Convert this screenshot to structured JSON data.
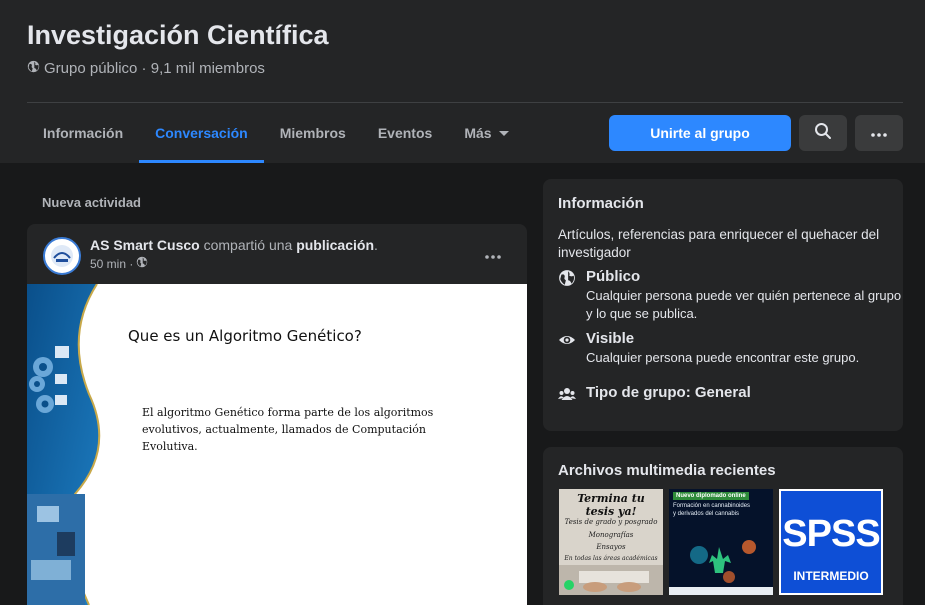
{
  "header": {
    "title": "Investigación Científica",
    "subtitle": "Grupo público · 9,1 mil miembros",
    "icon": "globe-icon"
  },
  "tabs": [
    {
      "label": "Información",
      "active": false
    },
    {
      "label": "Conversación",
      "active": true
    },
    {
      "label": "Miembros",
      "active": false
    },
    {
      "label": "Eventos",
      "active": false
    },
    {
      "label": "Más",
      "active": false
    }
  ],
  "actions": {
    "join_label": "Unirte al grupo",
    "search_icon": "search-icon",
    "more_icon": "more-icon"
  },
  "feed": {
    "section_label": "Nueva actividad",
    "post": {
      "author": "AS Smart Cusco",
      "action_text": " compartió una ",
      "object_text": "publicación",
      "period": ".",
      "time": "50 min ·",
      "slide": {
        "title": "Que es un Algoritmo Genético?",
        "body": "El algoritmo Genético forma parte de los algoritmos evolutivos, actualmente, llamados de Computación Evolutiva."
      }
    }
  },
  "info": {
    "title": "Información",
    "description": "Artículos, referencias para enriquecer el quehacer del investigador",
    "items": [
      {
        "title": "Público",
        "desc": "Cualquier persona puede ver quién pertenece al grupo y lo que se publica.",
        "icon": "globe-icon"
      },
      {
        "title": "Visible",
        "desc": "Cualquier persona puede encontrar este grupo.",
        "icon": "eye-icon"
      },
      {
        "title": "Tipo de grupo: General",
        "desc": "",
        "icon": "people-icon"
      }
    ]
  },
  "media": {
    "title": "Archivos multimedia recientes",
    "thumbs": [
      {
        "headline": "Termina tu tesis ya!",
        "lines": [
          "Tesis de grado y posgrado",
          "Monografías",
          "Ensayos",
          "En todas las áreas académicas"
        ]
      },
      {
        "headline": "Nuevo diplomado online",
        "lines": [
          "Formación en cannabinoides",
          "y derivados del cannabis"
        ]
      },
      {
        "headline": "SPSS",
        "lines": [
          "INTERMEDIO"
        ]
      }
    ]
  },
  "colors": {
    "accent": "#2d88ff",
    "background": "#18191a",
    "surface": "#242526"
  }
}
